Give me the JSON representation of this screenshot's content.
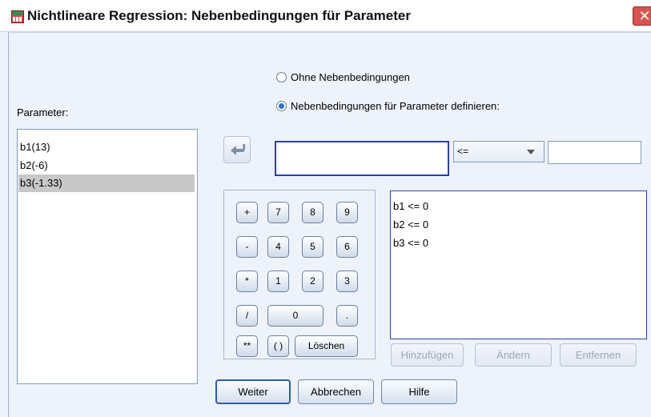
{
  "window": {
    "title": "Nichtlineare Regression: Nebenbedingungen für Parameter",
    "close": "✕"
  },
  "options": {
    "none": "Ohne Nebenbedingungen",
    "define": "Nebenbedingungen für Parameter definieren:",
    "selected": "define"
  },
  "parameters": {
    "label": "Parameter:",
    "items": [
      "b1(13)",
      "b2(-6)",
      "b3(-1.33)"
    ],
    "selected_index": 2
  },
  "constraint_editor": {
    "expression": "",
    "operator": "<=",
    "value": ""
  },
  "keypad": {
    "rows": [
      [
        "+",
        "7",
        "8",
        "9"
      ],
      [
        "-",
        "4",
        "5",
        "6"
      ],
      [
        "*",
        "1",
        "2",
        "3"
      ],
      [
        "/",
        "0",
        "."
      ],
      [
        "**",
        "( )",
        "Löschen"
      ]
    ]
  },
  "constraints_list": [
    "b1 <= 0",
    "b2 <= 0",
    "b3 <= 0"
  ],
  "list_buttons": {
    "add": "Hinzufügen",
    "change": "Ändern",
    "remove": "Entfernen"
  },
  "footer": {
    "continue": "Weiter",
    "cancel": "Abbrechen",
    "help": "Hilfe"
  }
}
